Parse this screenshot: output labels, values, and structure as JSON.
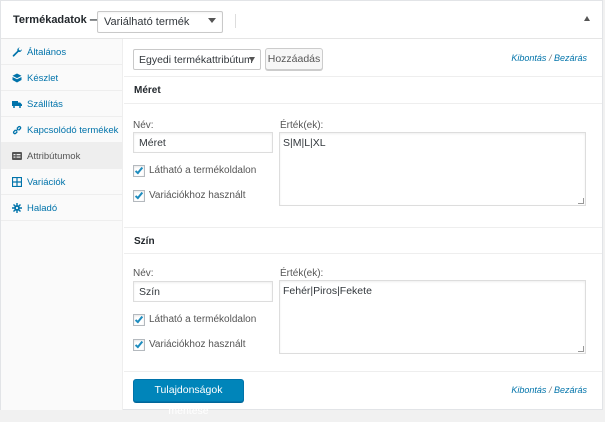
{
  "header": {
    "title": "Termékadatok —",
    "product_type": "Variálható termék"
  },
  "sidebar": {
    "items": [
      {
        "label": "Általános",
        "icon": "wrench-icon"
      },
      {
        "label": "Készlet",
        "icon": "inventory-icon"
      },
      {
        "label": "Szállítás",
        "icon": "truck-icon"
      },
      {
        "label": "Kapcsolódó termékek",
        "icon": "link-icon"
      },
      {
        "label": "Attribútumok",
        "icon": "attributes-icon",
        "active": true
      },
      {
        "label": "Variációk",
        "icon": "grid-icon"
      },
      {
        "label": "Haladó",
        "icon": "gear-icon"
      }
    ]
  },
  "toolbar": {
    "attribute_select": "Egyedi termékattribútum",
    "add_label": "Hozzáadás",
    "expand_label": "Kibontás",
    "separator": "/",
    "close_label": "Bezárás"
  },
  "attributes": [
    {
      "title": "Méret",
      "name_label": "Név:",
      "name_value": "Méret",
      "values_label": "Érték(ek):",
      "values": "S|M|L|XL",
      "visible_label": "Látható a termékoldalon",
      "visible": true,
      "variation_label": "Variációkhoz használt",
      "variation": true
    },
    {
      "title": "Szín",
      "name_label": "Név:",
      "name_value": "Szín",
      "values_label": "Érték(ek):",
      "values": "Fehér|Piros|Fekete",
      "visible_label": "Látható a termékoldalon",
      "visible": true,
      "variation_label": "Variációkhoz használt",
      "variation": true
    }
  ],
  "footer": {
    "save_label": "Tulajdonságok mentése",
    "expand_label": "Kibontás",
    "separator": "/",
    "close_label": "Bezárás"
  },
  "colors": {
    "accent": "#0085ba",
    "link": "#0073aa",
    "checkbox_tick": "#1e8cbe"
  }
}
